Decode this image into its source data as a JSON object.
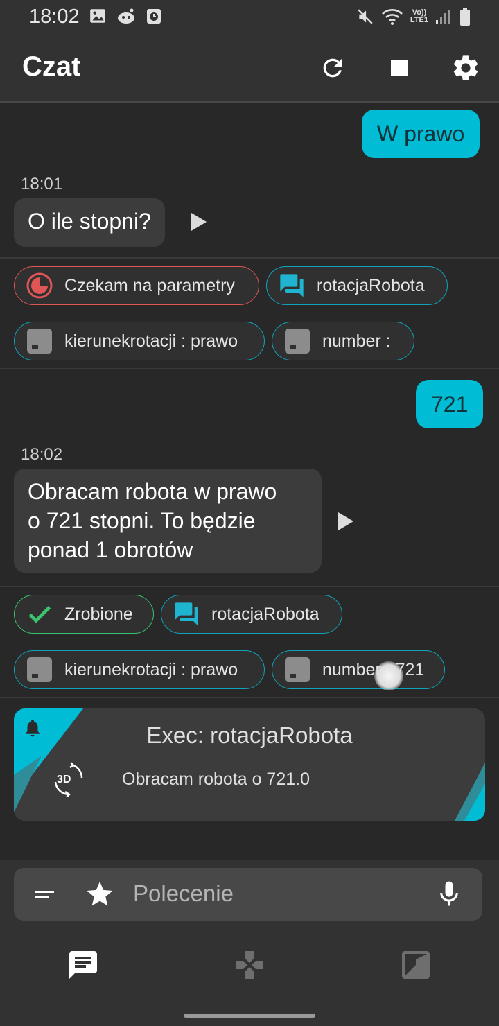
{
  "status_bar": {
    "time": "18:02",
    "icons_left": [
      "image-icon",
      "reddit-icon",
      "clock-app-icon"
    ],
    "icons_right": [
      "mute-icon",
      "wifi-icon",
      "volte-lte-icon",
      "signal-icon",
      "battery-icon"
    ],
    "network_label_top": "Vo))",
    "network_label_bottom": "LTE1"
  },
  "app_bar": {
    "title": "Czat",
    "actions": [
      "refresh-icon",
      "stop-icon",
      "settings-icon"
    ]
  },
  "messages": [
    {
      "type": "user",
      "text": "W prawo"
    },
    {
      "type": "bot",
      "time": "18:01",
      "text": "O ile stopni?"
    },
    {
      "type": "user",
      "text": "721"
    },
    {
      "type": "bot",
      "time": "18:02",
      "lines": [
        "Obracam robota w prawo",
        "o 721 stopni. To będzie",
        "ponad 1 obrotów"
      ]
    }
  ],
  "chip_groups": [
    {
      "status": {
        "label": "Czekam na parametry",
        "icon": "pending-icon"
      },
      "intent": {
        "label": "rotacjaRobota",
        "icon": "chat-icon"
      },
      "params": [
        {
          "label": "kierunekrotacji : prawo",
          "icon": "parameter-icon"
        },
        {
          "label": "number :",
          "icon": "parameter-icon"
        }
      ]
    },
    {
      "status": {
        "label": "Zrobione",
        "icon": "check-icon"
      },
      "intent": {
        "label": "rotacjaRobota",
        "icon": "chat-icon"
      },
      "params": [
        {
          "label": "kierunekrotacji : prawo",
          "icon": "parameter-icon"
        },
        {
          "label": "number : 721",
          "icon": "parameter-icon"
        }
      ]
    }
  ],
  "exec_card": {
    "title": "Exec: rotacjaRobota",
    "text": "Obracam robota o 721.0",
    "badge_icon": "rotate-3d-icon",
    "corner_icon": "bell-icon"
  },
  "input": {
    "placeholder": "Polecenie",
    "icons": [
      "menu-lines-icon",
      "star-icon",
      "mic-icon"
    ]
  },
  "bottom_nav": [
    "chat-tab-icon",
    "gamepad-tab-icon",
    "map-tab-icon"
  ],
  "colors": {
    "accent": "#00bcd4",
    "background": "#282828",
    "bar": "#323232",
    "bubble_bot": "#3c3c3c",
    "chip_red": "#e05555",
    "chip_green": "#3cc26e"
  }
}
